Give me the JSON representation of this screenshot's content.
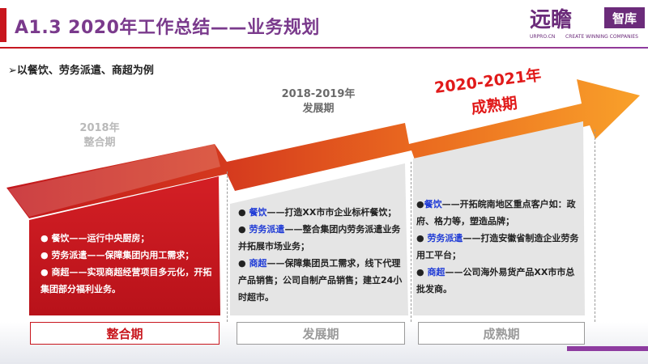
{
  "header": {
    "title": "A1.3  2020年工作总结——业务规划"
  },
  "logo": {
    "script_text": "远瞻",
    "box_text": "智库",
    "small_left": "URPRO.CN",
    "small_right": "CREATE WINNING COMPANIES"
  },
  "subtitle": "➢以餐饮、劳务派遣、商超为例",
  "stages": [
    {
      "year": "2018年",
      "name": "整合期",
      "items": [
        {
          "prefix": "● ",
          "label": "餐饮",
          "text": "——运行中央厨房；"
        },
        {
          "prefix": "● ",
          "label": "劳务派遣",
          "text": "——保障集团内用工需求；"
        },
        {
          "prefix": "● ",
          "label": "商超",
          "text": "——实现商超经营项目多元化，开拓集团部分福利业务。"
        }
      ],
      "button": "整合期"
    },
    {
      "year": "2018-2019年",
      "name": "发展期",
      "items": [
        {
          "prefix": "● ",
          "label": "餐饮",
          "text": "——打造XX市市企业标杆餐饮；"
        },
        {
          "prefix": "● ",
          "label": "劳务派遣",
          "text": "——整合集团内劳务派遣业务并拓展市场业务；"
        },
        {
          "prefix": "● ",
          "label": "商超",
          "text": "——保障集团员工需求，线下代理产品销售；公司自制产品销售；建立24小时超市。"
        }
      ],
      "button": "发展期"
    },
    {
      "year": "2020-2021年",
      "name": "成熟期",
      "items": [
        {
          "prefix": "●",
          "label": "餐饮",
          "text": "——开拓皖南地区重点客户如：政府、格力等，塑造品牌；"
        },
        {
          "prefix": "● ",
          "label": "劳务派遣",
          "text": "——打造安徽省制造企业劳务用工平台；"
        },
        {
          "prefix": "● ",
          "label": "商超",
          "text": "——公司海外易货产品XX市市总批发商。"
        }
      ],
      "button": "成熟期"
    }
  ],
  "colors": {
    "accent_red": "#c8161d",
    "brand_purple": "#7a3a8c",
    "highlight_blue": "#1f3bd6",
    "arrow_orange": "#f7941d"
  }
}
